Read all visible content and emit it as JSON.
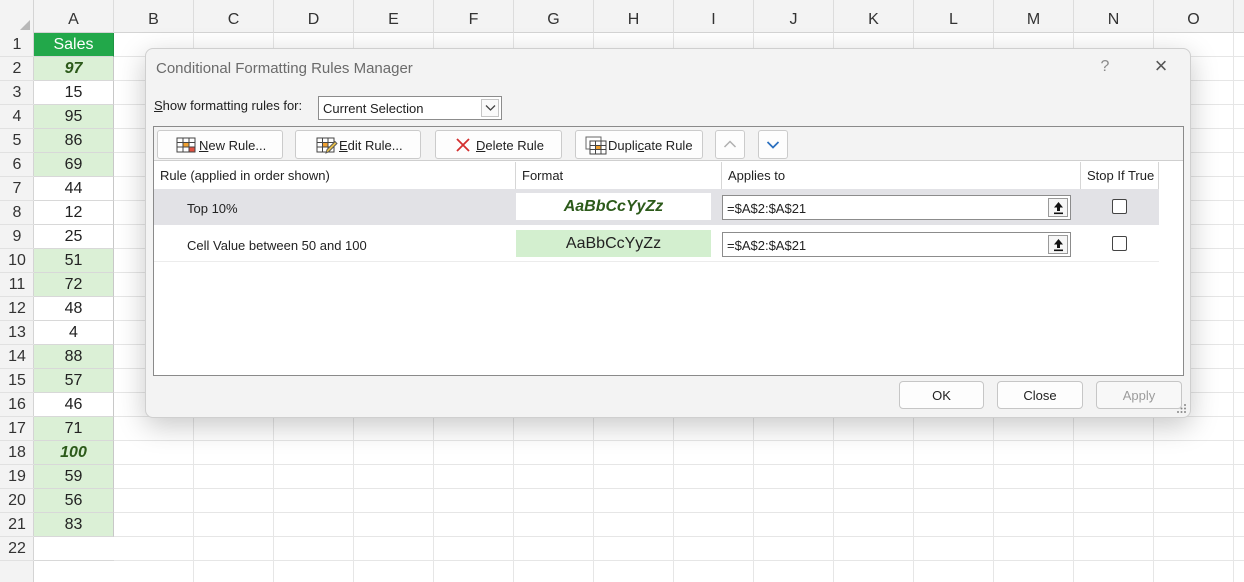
{
  "sheet": {
    "columns": [
      "A",
      "B",
      "C",
      "D",
      "E",
      "F",
      "G",
      "H",
      "I",
      "J",
      "K",
      "L",
      "M",
      "N",
      "O"
    ],
    "rows": [
      "1",
      "2",
      "3",
      "4",
      "5",
      "6",
      "7",
      "8",
      "9",
      "10",
      "11",
      "12",
      "13",
      "14",
      "15",
      "16",
      "17",
      "18",
      "19",
      "20",
      "21",
      "22"
    ],
    "column_a": [
      {
        "value": "Sales",
        "style": "header"
      },
      {
        "value": "97",
        "style": "top"
      },
      {
        "value": "15",
        "style": "plain"
      },
      {
        "value": "95",
        "style": "green"
      },
      {
        "value": "86",
        "style": "green"
      },
      {
        "value": "69",
        "style": "green"
      },
      {
        "value": "44",
        "style": "plain"
      },
      {
        "value": "12",
        "style": "plain"
      },
      {
        "value": "25",
        "style": "plain"
      },
      {
        "value": "51",
        "style": "green"
      },
      {
        "value": "72",
        "style": "green"
      },
      {
        "value": "48",
        "style": "plain"
      },
      {
        "value": "4",
        "style": "plain"
      },
      {
        "value": "88",
        "style": "green"
      },
      {
        "value": "57",
        "style": "green"
      },
      {
        "value": "46",
        "style": "plain"
      },
      {
        "value": "71",
        "style": "green"
      },
      {
        "value": "100",
        "style": "top"
      },
      {
        "value": "59",
        "style": "green"
      },
      {
        "value": "56",
        "style": "green"
      },
      {
        "value": "83",
        "style": "green"
      },
      {
        "value": "",
        "style": "empty"
      }
    ],
    "colors": {
      "header_fill": "#22a84a",
      "rule_fill": "#dbf0d6",
      "top_text": "#2c5a1a"
    }
  },
  "dialog": {
    "title": "Conditional Formatting Rules Manager",
    "help": "?",
    "close": "×",
    "show_label_key": "S",
    "show_label_rest": "how formatting rules for:",
    "show_value": "Current Selection",
    "toolbar": {
      "new_rule_key": "N",
      "new_rule_rest": "ew Rule...",
      "edit_rule_key": "E",
      "edit_rule_rest": "dit Rule...",
      "delete_rule_key": "D",
      "delete_rule_rest": "elete Rule",
      "duplicate_rule_pre": "Dupli",
      "duplicate_rule_key": "c",
      "duplicate_rule_post": "ate Rule"
    },
    "columns": {
      "rule": "Rule (applied in order shown)",
      "format": "Format",
      "applies_to": "Applies to",
      "stop": "Stop If True"
    },
    "rules": [
      {
        "name": "Top 10%",
        "preview": "AaBbCcYyZz",
        "applies_to": "=$A$2:$A$21",
        "stop_if_true": false
      },
      {
        "name": "Cell Value between 50 and 100",
        "preview": "AaBbCcYyZz",
        "applies_to": "=$A$2:$A$21",
        "stop_if_true": false
      }
    ],
    "buttons": {
      "ok": "OK",
      "close": "Close",
      "apply": "Apply"
    }
  }
}
